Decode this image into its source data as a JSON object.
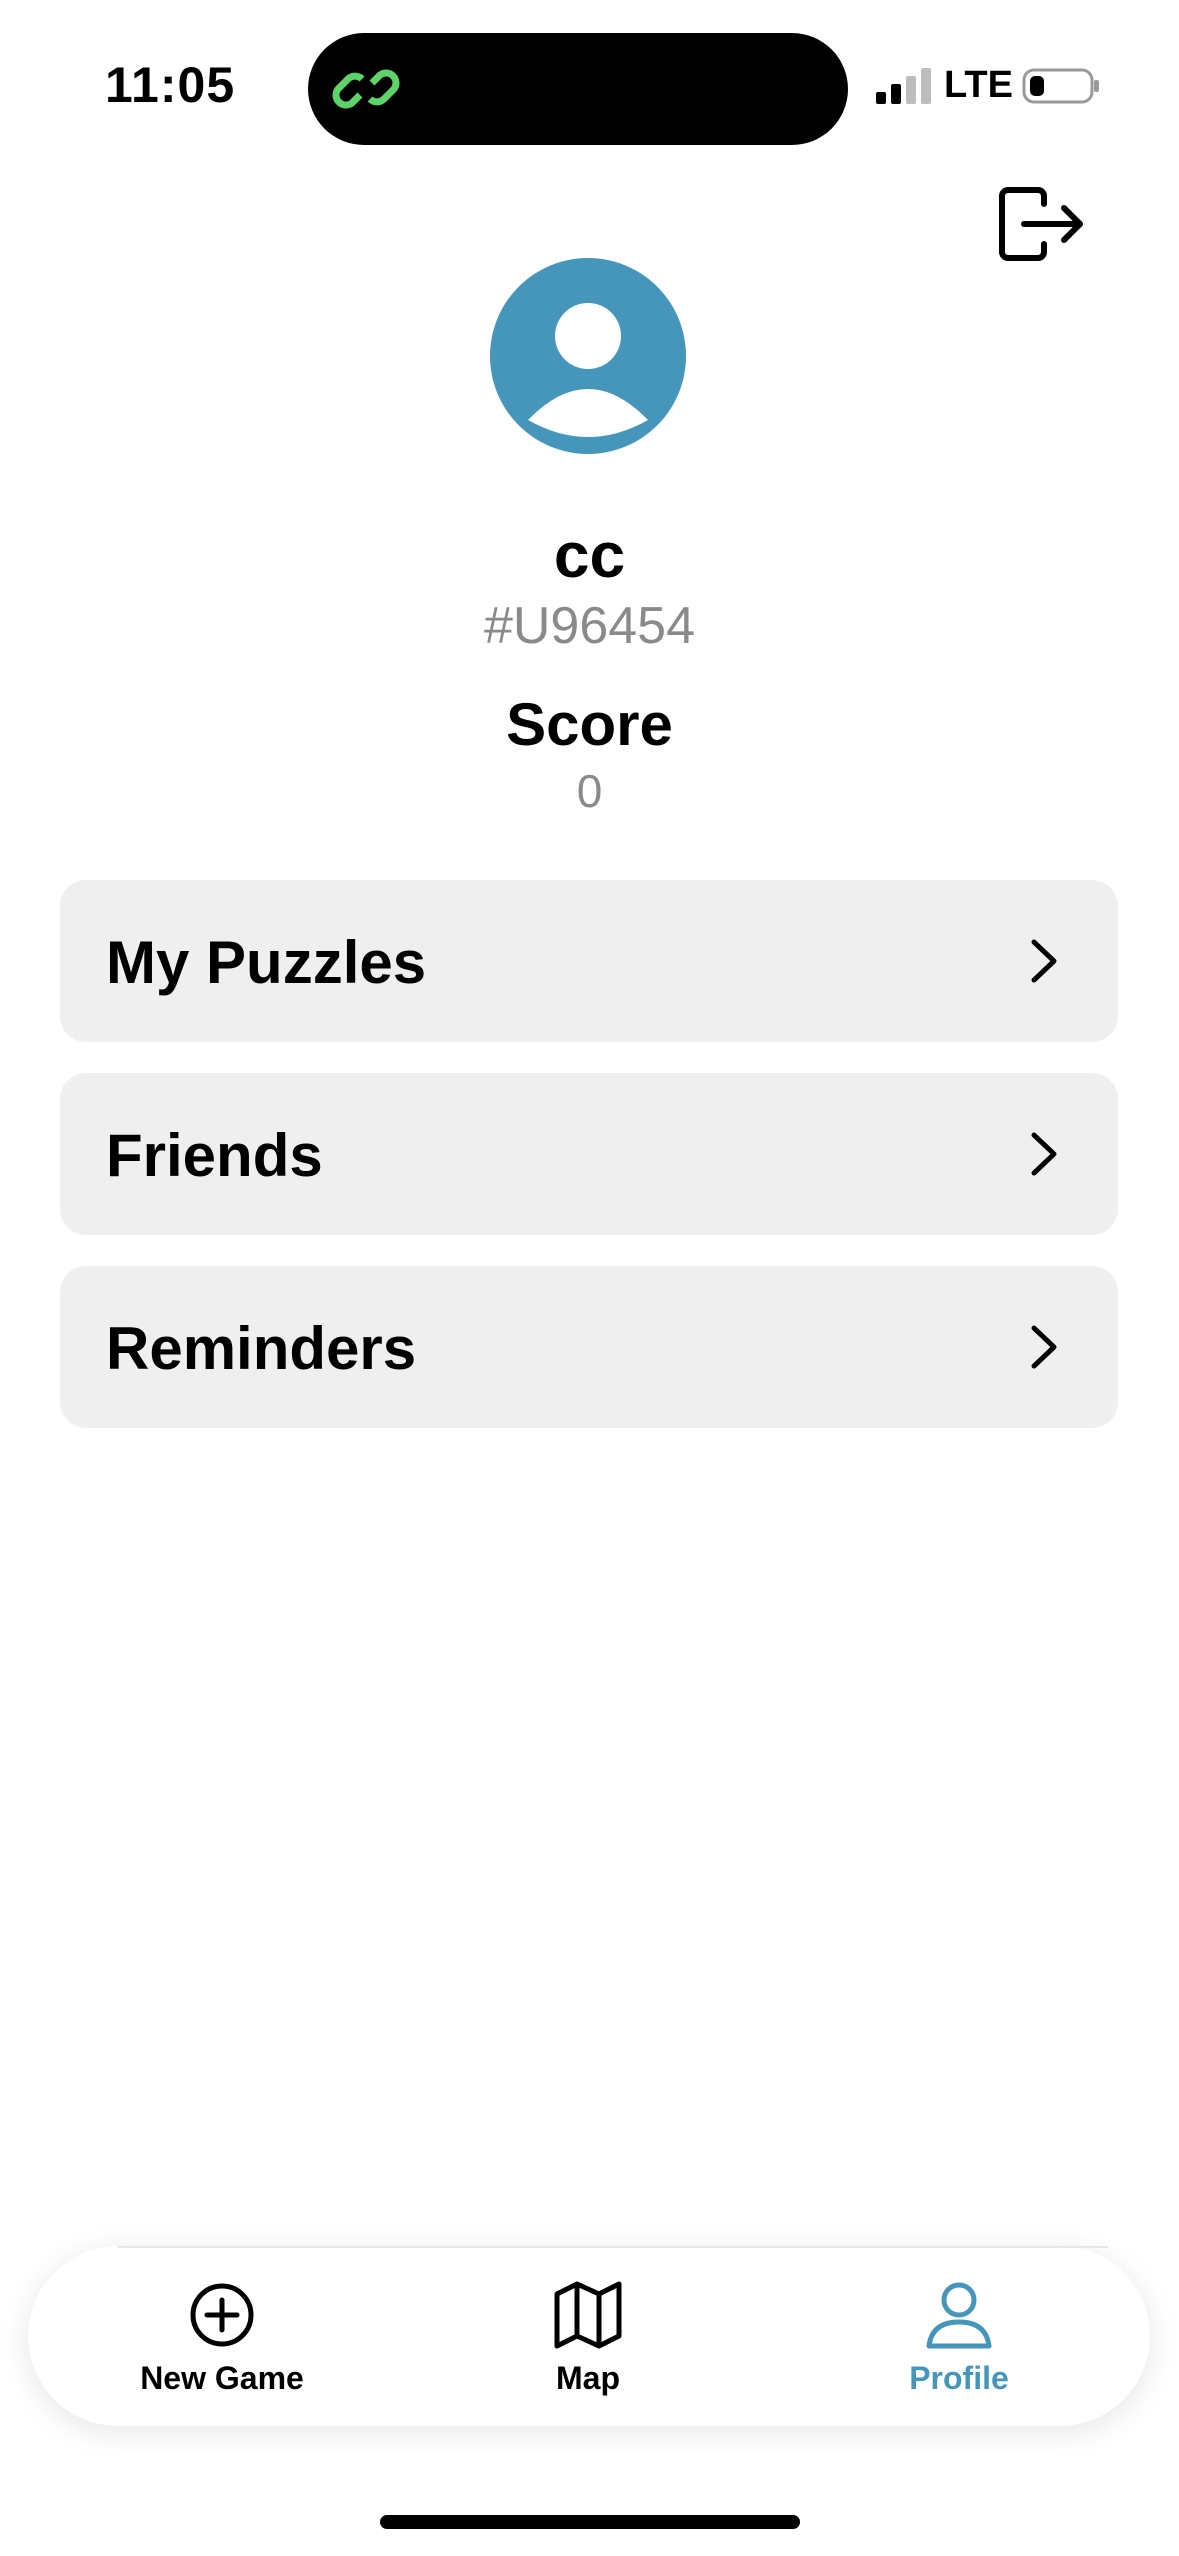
{
  "status_bar": {
    "time": "11:05",
    "network": "LTE",
    "signal_bars_filled": 2,
    "signal_bars_total": 4,
    "battery_level": 0.2,
    "island_icon": "linked-rings-icon",
    "island_icon_color": "#5dd36a"
  },
  "header": {
    "logout_icon": "logout-icon"
  },
  "profile": {
    "avatar_icon": "user-avatar-icon",
    "avatar_color": "#4596ba",
    "username": "cc",
    "user_id": "#U96454",
    "score_label": "Score",
    "score_value": "0"
  },
  "menu": {
    "items": [
      {
        "label": "My Puzzles",
        "icon": "chevron-right-icon"
      },
      {
        "label": "Friends",
        "icon": "chevron-right-icon"
      },
      {
        "label": "Reminders",
        "icon": "chevron-right-icon"
      }
    ]
  },
  "tab_bar": {
    "accent_color": "#4596ba",
    "tabs": [
      {
        "label": "New Game",
        "icon": "plus-circle-icon",
        "active": false
      },
      {
        "label": "Map",
        "icon": "map-icon",
        "active": false
      },
      {
        "label": "Profile",
        "icon": "person-icon",
        "active": true
      }
    ]
  }
}
